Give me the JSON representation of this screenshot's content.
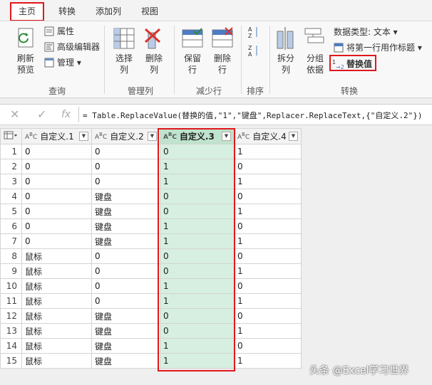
{
  "tabs": [
    "主页",
    "转换",
    "添加列",
    "视图"
  ],
  "ribbon": {
    "refresh": "刷新\n预览",
    "properties": "属性",
    "advanced_editor": "高级编辑器",
    "manage": "管理",
    "choose_cols": "选择\n列",
    "remove_cols": "删除\n列",
    "keep_rows": "保留\n行",
    "remove_rows": "删除\n行",
    "split_col": "拆分\n列",
    "group_by": "分组\n依据",
    "data_type": "数据类型: 文本",
    "first_row_header": "将第一行用作标题",
    "replace_values": "替换值",
    "groups": {
      "query": "查询",
      "manage_cols": "管理列",
      "reduce_rows": "减少行",
      "sort": "排序",
      "transform": "转换"
    }
  },
  "formula_bar": {
    "fx": "fx",
    "text": "= Table.ReplaceValue(替换的值,\"1\",\"键盘\",Replacer.ReplaceText,{\"自定义.2\"})"
  },
  "table": {
    "columns": [
      "自定义.1",
      "自定义.2",
      "自定义.3",
      "自定义.4"
    ],
    "rows": [
      [
        "1",
        "0",
        "0",
        "0",
        "1"
      ],
      [
        "2",
        "0",
        "0",
        "1",
        "0"
      ],
      [
        "3",
        "0",
        "0",
        "1",
        "1"
      ],
      [
        "4",
        "0",
        "键盘",
        "0",
        "0"
      ],
      [
        "5",
        "0",
        "键盘",
        "0",
        "1"
      ],
      [
        "6",
        "0",
        "键盘",
        "1",
        "0"
      ],
      [
        "7",
        "0",
        "键盘",
        "1",
        "1"
      ],
      [
        "8",
        "鼠标",
        "0",
        "0",
        "0"
      ],
      [
        "9",
        "鼠标",
        "0",
        "0",
        "1"
      ],
      [
        "10",
        "鼠标",
        "0",
        "1",
        "0"
      ],
      [
        "11",
        "鼠标",
        "0",
        "1",
        "1"
      ],
      [
        "12",
        "鼠标",
        "键盘",
        "0",
        "0"
      ],
      [
        "13",
        "鼠标",
        "键盘",
        "0",
        "1"
      ],
      [
        "14",
        "鼠标",
        "键盘",
        "1",
        "0"
      ],
      [
        "15",
        "鼠标",
        "键盘",
        "1",
        "1"
      ]
    ]
  },
  "watermark": "头条 @Excel学习世界"
}
